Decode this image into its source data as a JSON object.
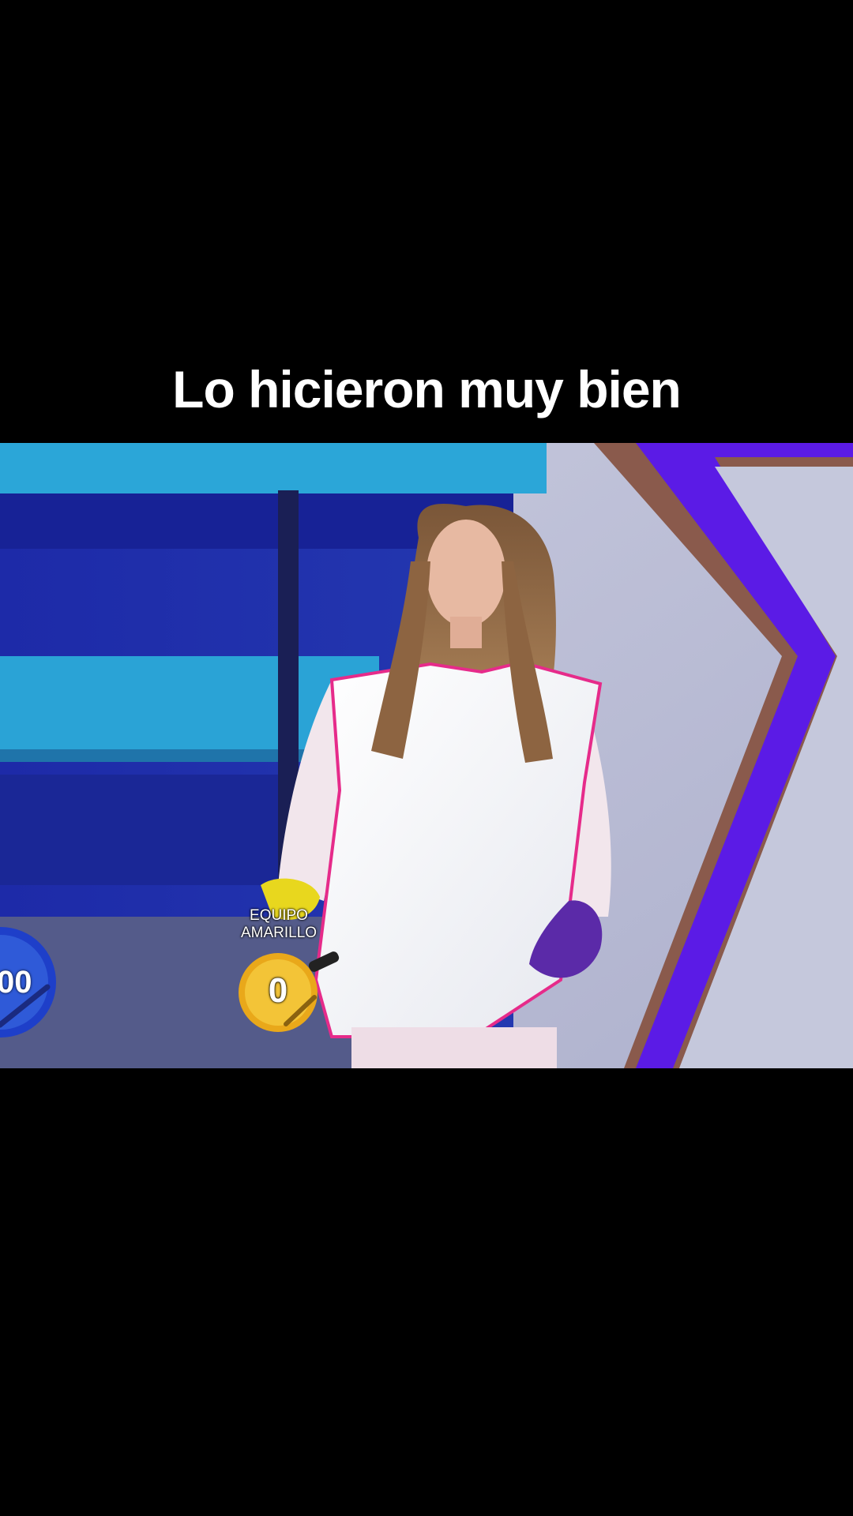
{
  "caption": "Lo hicieron muy bien",
  "overlay": {
    "team_label": "EQUIPO\nAMARILLO",
    "yellow_score": "0",
    "blue_score": "00"
  }
}
